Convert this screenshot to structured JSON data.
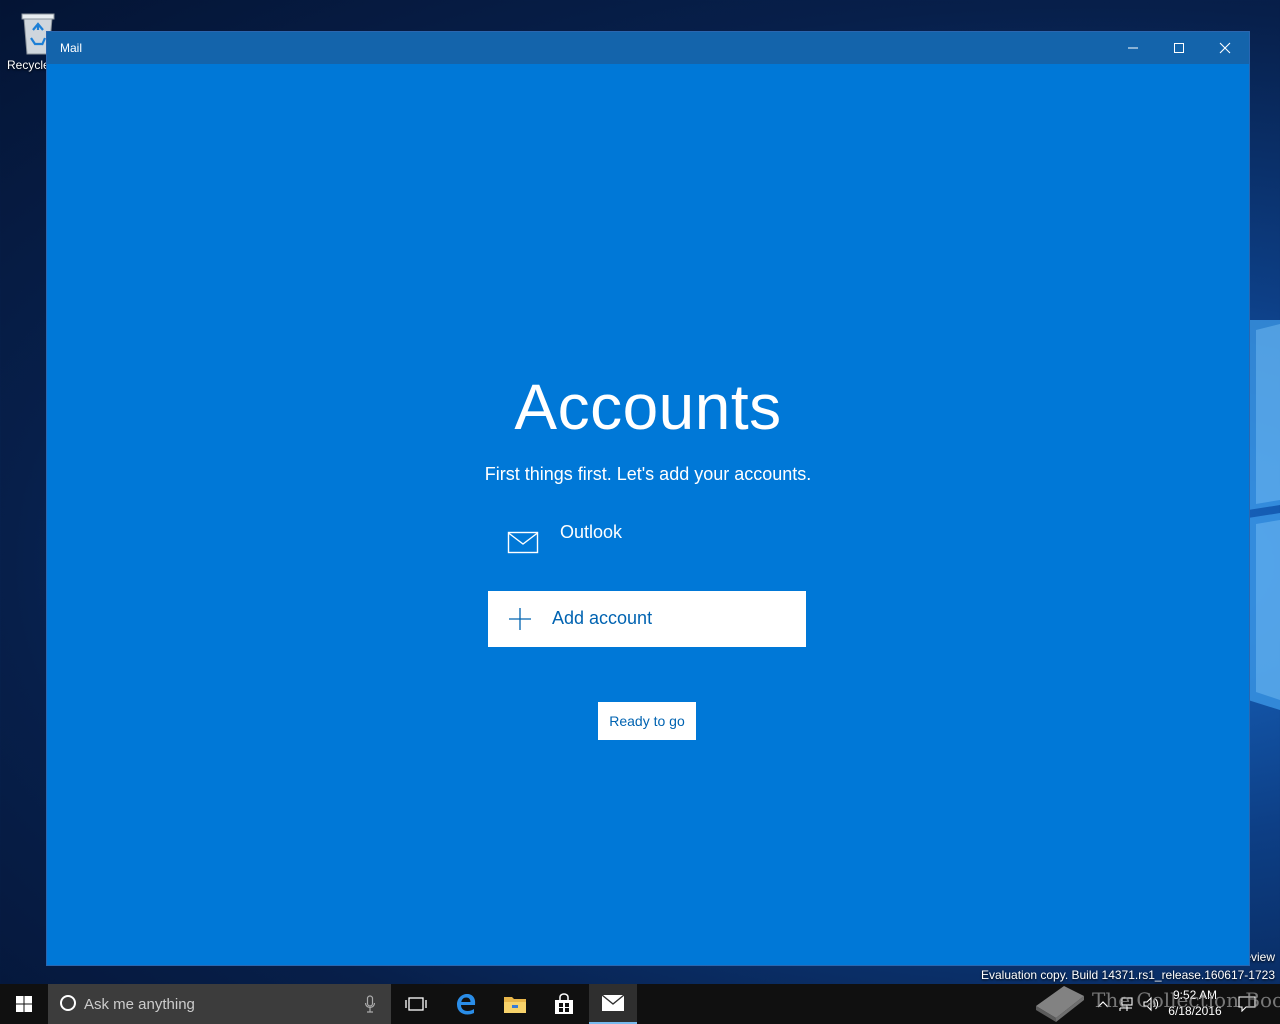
{
  "desktop": {
    "recycle_bin_label": "Recycle",
    "watermark_line1": "eview",
    "watermark_line2": "Evaluation copy. Build 14371.rs1_release.160617-1723",
    "overlay_text": "The Collection Book"
  },
  "window": {
    "title": "Mail",
    "accent_color": "#0078d7",
    "titlebar_color": "#1464ab"
  },
  "main": {
    "heading": "Accounts",
    "subtitle": "First things first. Let's add your accounts.",
    "accounts": [
      {
        "name": "Outlook",
        "icon": "mail-icon"
      }
    ],
    "add_account_label": "Add account",
    "ready_button_label": "Ready to go"
  },
  "taskbar": {
    "search_placeholder": "Ask me anything",
    "pinned_apps": [
      "task-view-icon",
      "edge-icon",
      "file-explorer-icon",
      "store-icon",
      "mail-icon"
    ],
    "active_app": "Mail",
    "clock_time": "9:52 AM",
    "clock_date": "6/18/2016"
  }
}
